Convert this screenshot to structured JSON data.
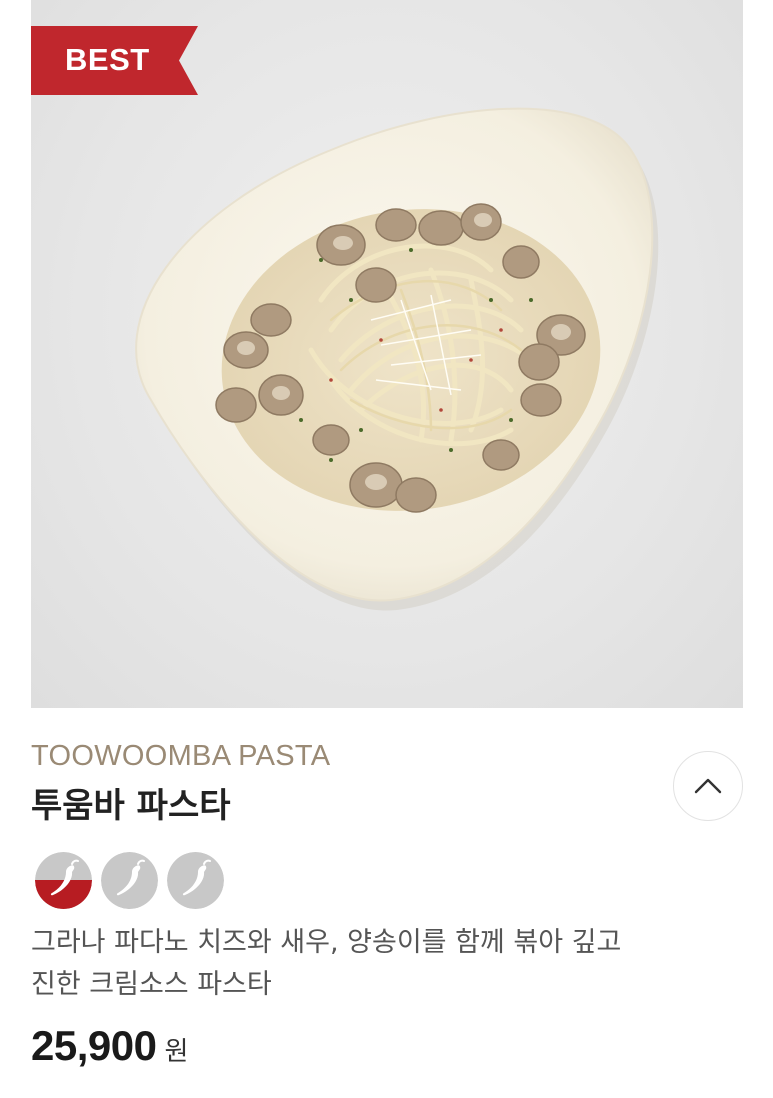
{
  "product": {
    "badge": "BEST",
    "name_en": "TOOWOOMBA PASTA",
    "name_ko": "투움바 파스타",
    "description_lines": [
      "그라나 파다노 치즈와 새우, 양송이를 함께 볶아 깊고",
      "진한 크림소스 파스타"
    ],
    "price": "25,900",
    "currency": "원",
    "spice_level": {
      "value": 1,
      "max": 3
    }
  },
  "icons": {
    "collapse": "chevron-up-icon",
    "spice": "chili-pepper-icon"
  },
  "colors": {
    "badge": "#c0272d",
    "spice_active": "#b71c22",
    "spice_inactive": "#c7c7c7",
    "eng_name": "#9a8a75"
  }
}
